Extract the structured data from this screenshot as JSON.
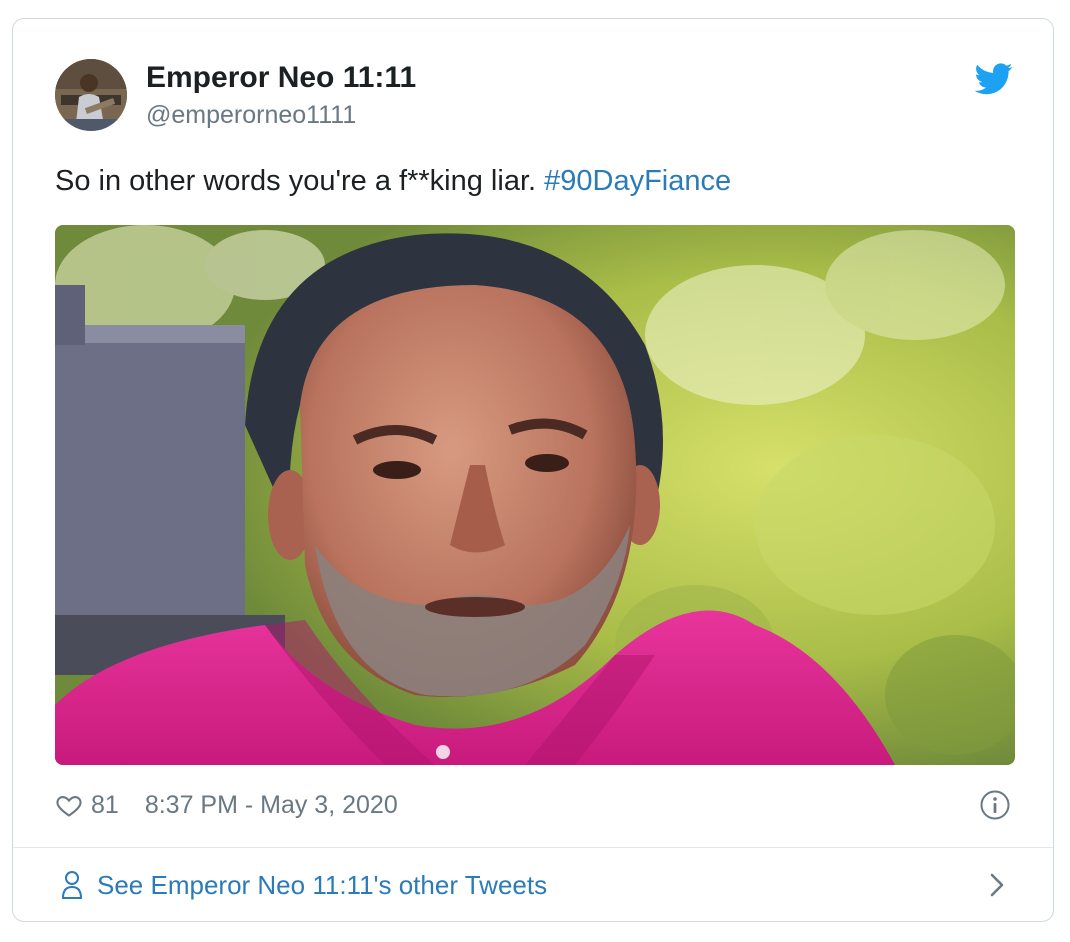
{
  "author": {
    "display_name": "Emperor Neo 11:11",
    "handle": "@emperorneo1111"
  },
  "tweet": {
    "text": "So in other words you're a f**king liar.",
    "hashtag": "#90DayFiance"
  },
  "stats": {
    "likes": "81",
    "timestamp": "8:37 PM - May 3, 2020"
  },
  "footer": {
    "label": "See Emperor Neo 11:11's other Tweets"
  },
  "icons": {
    "brand": "twitter-bird-icon",
    "like": "heart-icon",
    "info": "info-icon",
    "profile": "person-icon",
    "next": "chevron-right-icon"
  },
  "colors": {
    "brand": "#1da1f2",
    "link": "#2b7bb9",
    "text": "#1c2022",
    "muted": "#697882",
    "border": "#cfd9de",
    "shirt": "#e0268f"
  }
}
